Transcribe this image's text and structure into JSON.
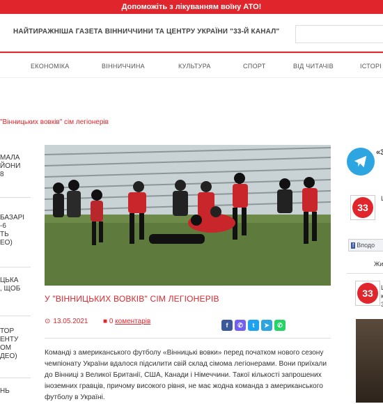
{
  "banner": {
    "text": "Допоможіть з лікуванням воїну АТО!"
  },
  "header": {
    "tagline": "НАЙТИРАЖНІША ГАЗЕТА ВІННИЧЧИНИ ТА ЦЕНТРУ УКРАЇНИ \"33-Й КАНАЛ\""
  },
  "nav": {
    "items": [
      "ЕКОНОМІКА",
      "ВІННИЧЧИНА",
      "КУЛЬТУРА",
      "СПОРТ",
      "ВІД ЧИТАЧІВ",
      "ІСТОРІ"
    ]
  },
  "breadcrumb": {
    "text": "\"Вінницьких вовків\" сім легіонерів"
  },
  "left_column": {
    "items": [
      "МАЛА\nЙОНИ\n8",
      "БАЗАРІ\n-6\nТЬ\nЕО)",
      "ЦЬКА\n, ЩОБ\n",
      "ТОР\nЕНТУ\nОМ\nДЕО)",
      "НЬ"
    ]
  },
  "article": {
    "title": "У \"ВІННИЦЬКИХ ВОВКІВ\" СІМ ЛЕГІОНЕРІВ",
    "date": "13.05.2021",
    "comments_count": "0",
    "comments_label": "коментарів",
    "body": "Команді з американського футболу «Вінницькі вовки» перед початком нового сезону чемпіонату України вдалося підсилити свій склад сімома легіонерами. Вони приїхали до Вінниці з Великої Британії, США, Канади і Німеччини. Такої кількості запрошених іноземних гравців, причому високого рівня, не має жодна команда з американського футболу в Україні."
  },
  "share": {
    "buttons": [
      {
        "icon": "facebook-icon",
        "glyph": "f",
        "color": "#3b5998"
      },
      {
        "icon": "viber-icon",
        "glyph": "✆",
        "color": "#7360f2"
      },
      {
        "icon": "twitter-icon",
        "glyph": "t",
        "color": "#1da1f2"
      },
      {
        "icon": "telegram-icon",
        "glyph": "➤",
        "color": "#2ca5e0"
      },
      {
        "icon": "whatsapp-icon",
        "glyph": "✆",
        "color": "#25d366"
      }
    ]
  },
  "right_column": {
    "telegram_label": "«3",
    "logo_text": "33",
    "fb_side_top": "L",
    "fb_button": "Вподо",
    "fb_tab": "Жи",
    "fb_post_lines": [
      "L",
      "к",
      "3"
    ]
  },
  "colors": {
    "accent": "#e0262c"
  }
}
